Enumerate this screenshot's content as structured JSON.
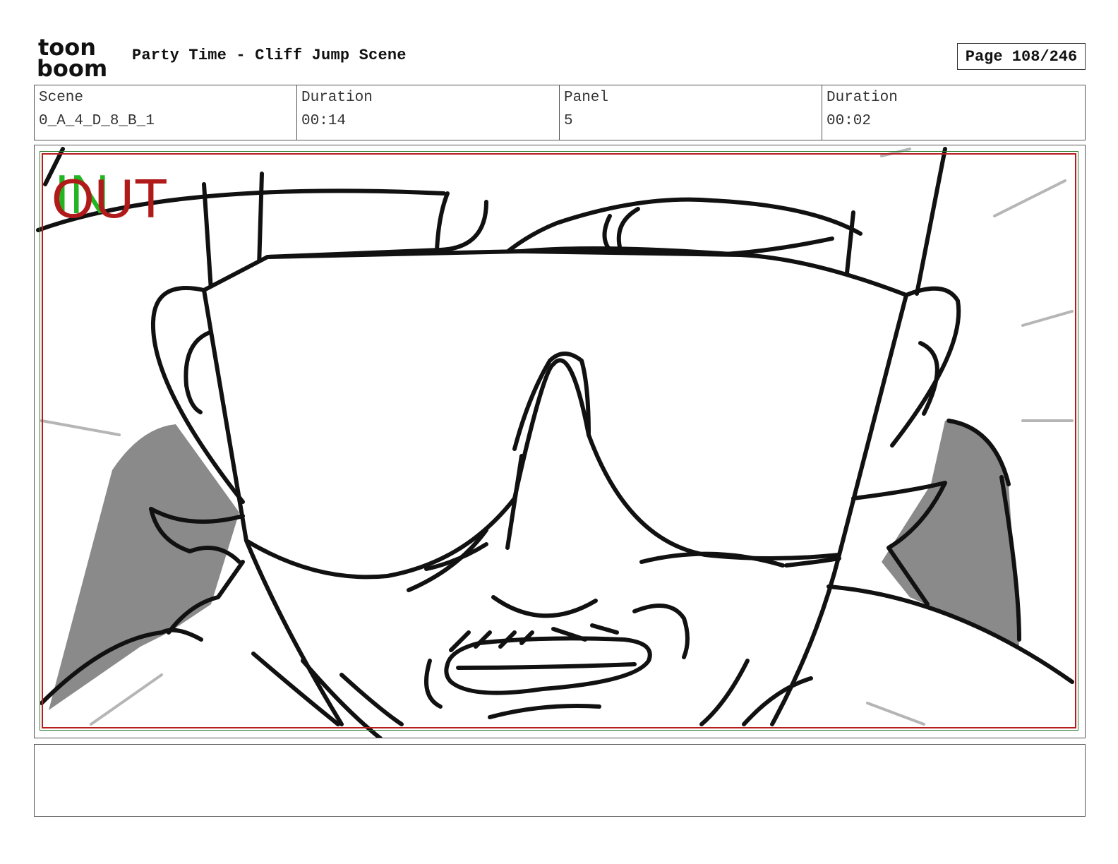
{
  "header": {
    "logo_top": "toon",
    "logo_bottom": "boom",
    "title": "Party Time - Cliff Jump Scene",
    "page": "Page 108/246"
  },
  "info": {
    "scene_label": "Scene",
    "scene_value": "0_A_4_D_8_B_1",
    "scene_duration_label": "Duration",
    "scene_duration_value": "00:14",
    "panel_label": "Panel",
    "panel_value": "5",
    "panel_duration_label": "Duration",
    "panel_duration_value": "00:02"
  },
  "panel_frame": {
    "in_marker": "IN",
    "out_marker": "OUT",
    "in_color": "#22b521",
    "out_color": "#b01a1a",
    "image_description_icon": "sketch-closeup-sunglasses-character"
  },
  "notes": {
    "text": ""
  }
}
